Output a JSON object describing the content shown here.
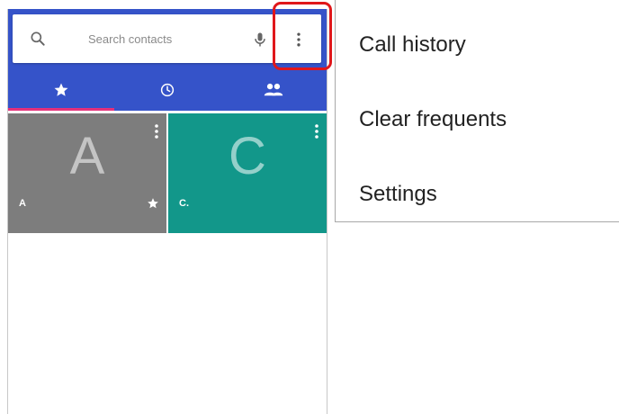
{
  "search": {
    "placeholder": "Search contacts"
  },
  "tabs": [
    {
      "icon": "star-icon",
      "selected": true
    },
    {
      "icon": "clock-icon",
      "selected": false
    },
    {
      "icon": "people-icon",
      "selected": false
    }
  ],
  "favorites": [
    {
      "letter": "A",
      "name": "A",
      "starred": true,
      "color": "#7d7d7d"
    },
    {
      "letter": "C",
      "name": "C.",
      "starred": false,
      "color": "#12978a"
    }
  ],
  "menu": {
    "items": [
      "Call history",
      "Clear frequents",
      "Settings"
    ]
  },
  "colors": {
    "appbar": "#3553c9",
    "tab_indicator": "#e6307a",
    "highlight": "#e0171b"
  }
}
